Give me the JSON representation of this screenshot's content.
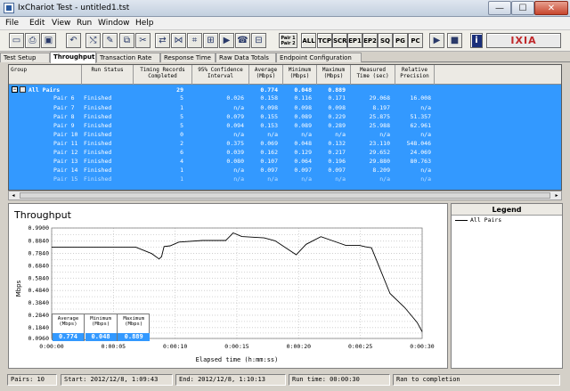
{
  "window": {
    "title": "IxChariot Test - untitled1.tst",
    "min": "—",
    "max": "☐",
    "close": "✕"
  },
  "menu": [
    "File",
    "Edit",
    "View",
    "Run",
    "Window",
    "Help"
  ],
  "toolbar": {
    "icon_buttons": [
      {
        "name": "new-icon",
        "glyph": "▭"
      },
      {
        "name": "print-icon",
        "glyph": "⎙"
      },
      {
        "name": "save-icon",
        "glyph": "▣"
      },
      {
        "name": "undo-icon",
        "glyph": "↶"
      },
      {
        "name": "add-pair-icon",
        "glyph": "⤭"
      },
      {
        "name": "edit-pair-icon",
        "glyph": "✎"
      },
      {
        "name": "copy-pair-icon",
        "glyph": "⧉"
      },
      {
        "name": "delete-pair-icon",
        "glyph": "✂"
      },
      {
        "name": "pair-run-icon",
        "glyph": "⇄"
      },
      {
        "name": "multicast-icon",
        "glyph": "⋈"
      },
      {
        "name": "net-icon",
        "glyph": "⌗"
      },
      {
        "name": "group-icon",
        "glyph": "⊞"
      },
      {
        "name": "video-icon",
        "glyph": "▶"
      },
      {
        "name": "voip-icon",
        "glyph": "☎"
      },
      {
        "name": "pair-group-icon",
        "glyph": "⊟"
      }
    ],
    "pair_label": "Pair 1 Pair 2",
    "text_buttons": [
      "ALL",
      "TCP",
      "SCR",
      "EP1",
      "EP2",
      "SQ",
      "PG",
      "PC"
    ],
    "run_icons": [
      {
        "name": "run-icon",
        "glyph": "▶"
      },
      {
        "name": "stop-icon",
        "glyph": "■"
      }
    ],
    "info_label": "i",
    "brand": "IXIA"
  },
  "tabs": [
    "Test Setup",
    "Throughput",
    "Transaction Rate",
    "Response Time",
    "Raw Data Totals",
    "Endpoint Configuration"
  ],
  "active_tab": "Throughput",
  "grid": {
    "columns": [
      [
        "Group",
        ""
      ],
      [
        "Run Status",
        ""
      ],
      [
        "Timing Records",
        "Completed"
      ],
      [
        "95% Confidence",
        "Interval"
      ],
      [
        "Average",
        "(Mbps)"
      ],
      [
        "Minimum",
        "(Mbps)"
      ],
      [
        "Maximum",
        "(Mbps)"
      ],
      [
        "Measured",
        "Time (sec)"
      ],
      [
        "Relative",
        "Precision"
      ]
    ],
    "parent": {
      "expand": "−",
      "group": "All Pairs",
      "records": "29",
      "average": "0.774",
      "minimum": "0.048",
      "maximum": "0.889"
    },
    "rows": [
      {
        "group": "Pair 6",
        "status": "Finished",
        "records": "5",
        "ci": "0.026",
        "avg": "0.158",
        "min": "0.116",
        "max": "0.171",
        "time": "29.068",
        "prec": "16.008"
      },
      {
        "group": "Pair 7",
        "status": "Finished",
        "records": "1",
        "ci": "n/a",
        "avg": "0.098",
        "min": "0.098",
        "max": "0.098",
        "time": "8.197",
        "prec": "n/a"
      },
      {
        "group": "Pair 8",
        "status": "Finished",
        "records": "5",
        "ci": "0.079",
        "avg": "0.155",
        "min": "0.089",
        "max": "0.229",
        "time": "25.875",
        "prec": "51.357"
      },
      {
        "group": "Pair 9",
        "status": "Finished",
        "records": "5",
        "ci": "0.094",
        "avg": "0.153",
        "min": "0.089",
        "max": "0.289",
        "time": "25.988",
        "prec": "62.961"
      },
      {
        "group": "Pair 10",
        "status": "Finished",
        "records": "0",
        "ci": "n/a",
        "avg": "n/a",
        "min": "n/a",
        "max": "n/a",
        "time": "n/a",
        "prec": "n/a"
      },
      {
        "group": "Pair 11",
        "status": "Finished",
        "records": "2",
        "ci": "0.375",
        "avg": "0.069",
        "min": "0.048",
        "max": "0.132",
        "time": "23.110",
        "prec": "548.046"
      },
      {
        "group": "Pair 12",
        "status": "Finished",
        "records": "6",
        "ci": "0.039",
        "avg": "0.162",
        "min": "0.129",
        "max": "0.217",
        "time": "29.652",
        "prec": "24.069"
      },
      {
        "group": "Pair 13",
        "status": "Finished",
        "records": "4",
        "ci": "0.080",
        "avg": "0.107",
        "min": "0.064",
        "max": "0.196",
        "time": "29.880",
        "prec": "80.763"
      },
      {
        "group": "Pair 14",
        "status": "Finished",
        "records": "1",
        "ci": "n/a",
        "avg": "0.097",
        "min": "0.097",
        "max": "0.097",
        "time": "8.209",
        "prec": "n/a"
      },
      {
        "group": "Pair 15",
        "status": "Finished",
        "records": "1",
        "ci": "n/a",
        "avg": "n/a",
        "min": "n/a",
        "max": "n/a",
        "time": "n/a",
        "prec": "n/a"
      }
    ]
  },
  "scroll": {
    "left": "◂",
    "right": "▸"
  },
  "chart_data": {
    "type": "line",
    "title": "Throughput",
    "xlabel": "Elapsed time (h:mm:ss)",
    "ylabel": "Mbps",
    "xlim": [
      0,
      30
    ],
    "ylim": [
      0.096,
      0.99
    ],
    "yticks": [
      0.99,
      0.9404,
      0.8907,
      0.8411,
      0.7914,
      0.7418,
      0.6921,
      0.6425,
      0.5929,
      0.5432,
      0.4936,
      0.4439,
      0.3943,
      0.3446,
      0.295,
      0.2453,
      0.1957,
      0.146,
      0.096
    ],
    "ytick_labels": [
      "0.9900",
      "",
      "0.8840",
      "",
      "0.7840",
      "",
      "0.6840",
      "",
      "0.5840",
      "",
      "0.4840",
      "",
      "0.3840",
      "",
      "0.2840",
      "",
      "0.1840",
      "",
      "0.0960"
    ],
    "ytick_values": [
      0.99,
      0.937,
      0.884,
      0.834,
      0.784,
      0.734,
      0.684,
      0.634,
      0.584,
      0.534,
      0.484,
      0.434,
      0.384,
      0.334,
      0.284,
      0.234,
      0.184,
      0.14,
      0.096
    ],
    "xticks": [
      0,
      5,
      10,
      15,
      20,
      25,
      30
    ],
    "xtick_labels": [
      "0:00:00",
      "0:00:05",
      "0:00:10",
      "0:00:15",
      "0:00:20",
      "0:00:25",
      "0:00:30"
    ],
    "grid": true,
    "series": [
      {
        "name": "All Pairs",
        "color": "#000000",
        "x": [
          0,
          3.4,
          6.8,
          8.1,
          8.7,
          8.9,
          9.1,
          9.6,
          10.3,
          12.2,
          14.1,
          14.7,
          15.4,
          17.2,
          18.1,
          19.8,
          20.6,
          21.8,
          23.8,
          24.9,
          25.4,
          25.9,
          27.4,
          28.6,
          29.6,
          30.0
        ],
        "y": [
          0.836,
          0.836,
          0.836,
          0.783,
          0.74,
          0.758,
          0.84,
          0.846,
          0.876,
          0.889,
          0.889,
          0.95,
          0.921,
          0.91,
          0.886,
          0.774,
          0.858,
          0.92,
          0.85,
          0.85,
          0.838,
          0.83,
          0.46,
          0.345,
          0.224,
          0.15
        ]
      }
    ],
    "legend": "right-pane"
  },
  "legend": {
    "title": "Legend",
    "entries": [
      "All Pairs"
    ]
  },
  "stats": [
    {
      "h1": "Average",
      "h2": "(Mbps)",
      "v": "0.774"
    },
    {
      "h1": "Minimum",
      "h2": "(Mbps)",
      "v": "0.048"
    },
    {
      "h1": "Maximum",
      "h2": "(Mbps)",
      "v": "0.889"
    }
  ],
  "status": {
    "pairs": "Pairs: 10",
    "start": "Start: 2012/12/8, 1:09:43",
    "end": "End: 2012/12/8, 1:10:13",
    "run_time": "Run time: 00:00:30",
    "result": "Ran to completion"
  }
}
